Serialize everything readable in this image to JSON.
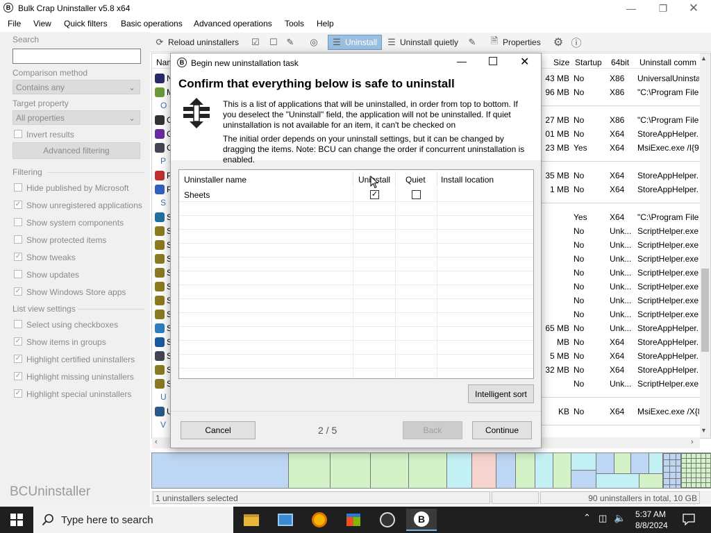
{
  "window": {
    "title": "Bulk Crap Uninstaller v5.8 x64",
    "icon_letter": "B"
  },
  "menu": [
    "File",
    "View",
    "Quick filters",
    "Basic operations",
    "Advanced operations",
    "Tools",
    "Help"
  ],
  "toolbar": {
    "reload": "Reload uninstallers",
    "uninstall": "Uninstall",
    "uninstall_quietly": "Uninstall quietly",
    "properties": "Properties"
  },
  "left_panel": {
    "search_label": "Search",
    "search_value": "",
    "comparison_label": "Comparison method",
    "comparison_value": "Contains any",
    "target_label": "Target property",
    "target_value": "All properties",
    "invert_results": "Invert results",
    "advanced_filtering": "Advanced filtering",
    "filtering_header": "Filtering",
    "filters": [
      {
        "label": "Hide published by Microsoft",
        "checked": false
      },
      {
        "label": "Show unregistered applications",
        "checked": true
      },
      {
        "label": "Show system components",
        "checked": false
      },
      {
        "label": "Show protected items",
        "checked": false
      },
      {
        "label": "Show tweaks",
        "checked": true
      },
      {
        "label": "Show updates",
        "checked": false
      },
      {
        "label": "Show Windows Store apps",
        "checked": true
      }
    ],
    "listview_header": "List view settings",
    "listview": [
      {
        "label": "Select using checkboxes",
        "checked": false
      },
      {
        "label": "Show items in groups",
        "checked": true
      },
      {
        "label": "Highlight certified uninstallers",
        "checked": true
      },
      {
        "label": "Highlight missing uninstallers",
        "checked": true
      },
      {
        "label": "Highlight special uninstallers",
        "checked": true
      }
    ],
    "brand": "BCUninstaller"
  },
  "list": {
    "headers": [
      "Nam",
      "Size",
      "Startup",
      "64bit",
      "Uninstall comm"
    ],
    "rows": [
      {
        "lead": "N",
        "size": "43 MB",
        "startup": "No",
        "bit": "X86",
        "cmd": "UniversalUninsta",
        "color": "#2a2a6a"
      },
      {
        "lead": "M",
        "size": "96 MB",
        "startup": "No",
        "bit": "X86",
        "cmd": "\"C:\\Program File",
        "color": "#6a9a3a"
      },
      {
        "group": "O"
      },
      {
        "lead": "C",
        "size": "27 MB",
        "startup": "No",
        "bit": "X86",
        "cmd": "\"C:\\Program File",
        "color": "#333"
      },
      {
        "lead": "C",
        "size": "01 MB",
        "startup": "No",
        "bit": "X64",
        "cmd": "StoreAppHelper.",
        "color": "#6a2aa0"
      },
      {
        "lead": "C",
        "size": "23 MB",
        "startup": "Yes",
        "bit": "X64",
        "cmd": "MsiExec.exe /I{9",
        "color": "#445"
      },
      {
        "group": "P"
      },
      {
        "lead": "P",
        "size": "35 MB",
        "startup": "No",
        "bit": "X64",
        "cmd": "StoreAppHelper.",
        "color": "#c03030"
      },
      {
        "lead": "P",
        "size": "1 MB",
        "startup": "No",
        "bit": "X64",
        "cmd": "StoreAppHelper.",
        "color": "#3060c0"
      },
      {
        "group": "S"
      },
      {
        "lead": "S",
        "size": "",
        "startup": "Yes",
        "bit": "X64",
        "cmd": "\"C:\\Program File",
        "color": "#2070a0"
      },
      {
        "lead": "S",
        "size": "",
        "startup": "No",
        "bit": "Unk...",
        "cmd": "ScriptHelper.exe",
        "color": "#8a7a20"
      },
      {
        "lead": "S",
        "size": "",
        "startup": "No",
        "bit": "Unk...",
        "cmd": "ScriptHelper.exe",
        "color": "#8a7a20"
      },
      {
        "lead": "S",
        "size": "",
        "startup": "No",
        "bit": "Unk...",
        "cmd": "ScriptHelper.exe",
        "color": "#8a7a20"
      },
      {
        "lead": "S",
        "size": "",
        "startup": "No",
        "bit": "Unk...",
        "cmd": "ScriptHelper.exe",
        "color": "#8a7a20"
      },
      {
        "lead": "S",
        "size": "",
        "startup": "No",
        "bit": "Unk...",
        "cmd": "ScriptHelper.exe",
        "color": "#8a7a20"
      },
      {
        "lead": "S",
        "size": "",
        "startup": "No",
        "bit": "Unk...",
        "cmd": "ScriptHelper.exe",
        "color": "#8a7a20"
      },
      {
        "lead": "S",
        "size": "",
        "startup": "No",
        "bit": "Unk...",
        "cmd": "ScriptHelper.exe",
        "color": "#8a7a20"
      },
      {
        "lead": "S",
        "size": "65 MB",
        "startup": "No",
        "bit": "Unk...",
        "cmd": "StoreAppHelper.",
        "color": "#2a80c0"
      },
      {
        "lead": "S",
        "size": "MB",
        "startup": "No",
        "bit": "X64",
        "cmd": "StoreAppHelper.",
        "color": "#1a5aa0"
      },
      {
        "lead": "S",
        "size": "5 MB",
        "startup": "No",
        "bit": "X64",
        "cmd": "StoreAppHelper.",
        "color": "#445"
      },
      {
        "lead": "S",
        "size": "32 MB",
        "startup": "No",
        "bit": "X64",
        "cmd": "StoreAppHelper.",
        "color": "#8a7a20"
      },
      {
        "lead": "S",
        "size": "",
        "startup": "No",
        "bit": "Unk...",
        "cmd": "ScriptHelper.exe",
        "color": "#8a7a20"
      },
      {
        "group": "U"
      },
      {
        "lead": "U",
        "size": "KB",
        "startup": "No",
        "bit": "X64",
        "cmd": "MsiExec.exe /X{8",
        "color": "#2a5a8a"
      },
      {
        "group": "V"
      }
    ]
  },
  "dialog": {
    "title": "Begin new uninstallation task",
    "heading": "Confirm that everything below is safe to uninstall",
    "para1": "This is a list of applications that will be uninstalled, in order from top to bottom. If you deselect the \"Uninstall\" field, the application will not be uninstalled. If quiet uninstallation is not available for an item, it can't be checked on",
    "para2": "The initial order depends on your uninstall settings, but it can be changed by dragging the items. Note: BCU can change the order if concurrent uninstallation is enabled.",
    "grid_headers": {
      "name": "Uninstaller name",
      "uninstall": "Uninstall",
      "quiet": "Quiet",
      "location": "Install location"
    },
    "grid_rows": [
      {
        "name": "Sheets",
        "uninstall": true,
        "quiet": false,
        "location": ""
      }
    ],
    "intelligent_sort": "Intelligent sort",
    "cancel": "Cancel",
    "step": "2 / 5",
    "back": "Back",
    "continue": "Continue"
  },
  "status": {
    "selected": "1 uninstallers selected",
    "total": "90 uninstallers in total, 10 GB"
  },
  "taskbar": {
    "search_placeholder": "Type here to search",
    "time": "5:37 AM",
    "date": "8/8/2024"
  }
}
